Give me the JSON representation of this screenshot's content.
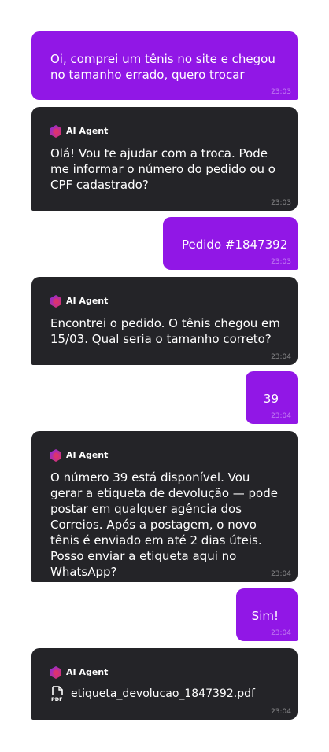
{
  "colors": {
    "user_bubble": "#9117e6",
    "agent_bubble": "#242428",
    "agent_icon_gradient": [
      "#8b2bd9",
      "#e8345c"
    ]
  },
  "agent": {
    "name": "AI Agent",
    "icon": "hexagon-logo-icon"
  },
  "messages": [
    {
      "sender": "user",
      "text": "Oi, comprei um tênis no site e chegou no tamanho errado, quero trocar",
      "time": "23:03"
    },
    {
      "sender": "agent",
      "text": "Olá! Vou te ajudar com a troca. Pode me informar o número do pedido ou o CPF cadastrado?",
      "time": "23:03"
    },
    {
      "sender": "user",
      "text": "Pedido #1847392",
      "time": "23:03"
    },
    {
      "sender": "agent",
      "text": "Encontrei o pedido. O tênis chegou em 15/03. Qual seria o tamanho correto?",
      "time": "23:04"
    },
    {
      "sender": "user",
      "text": "39",
      "time": "23:04"
    },
    {
      "sender": "agent",
      "text": "O número 39 está disponível. Vou gerar a etiqueta de devolução — pode postar em qualquer agência dos Correios. Após a postagem, o novo tênis é enviado em até 2 dias úteis. Posso enviar a etiqueta aqui no WhatsApp?",
      "time": "23:04"
    },
    {
      "sender": "user",
      "text": "Sim!",
      "time": "23:04"
    },
    {
      "sender": "agent",
      "attachment": {
        "file_name": "etiqueta_devolucao_1847392.pdf",
        "icon": "pdf-file-icon"
      },
      "time": "23:04"
    }
  ]
}
